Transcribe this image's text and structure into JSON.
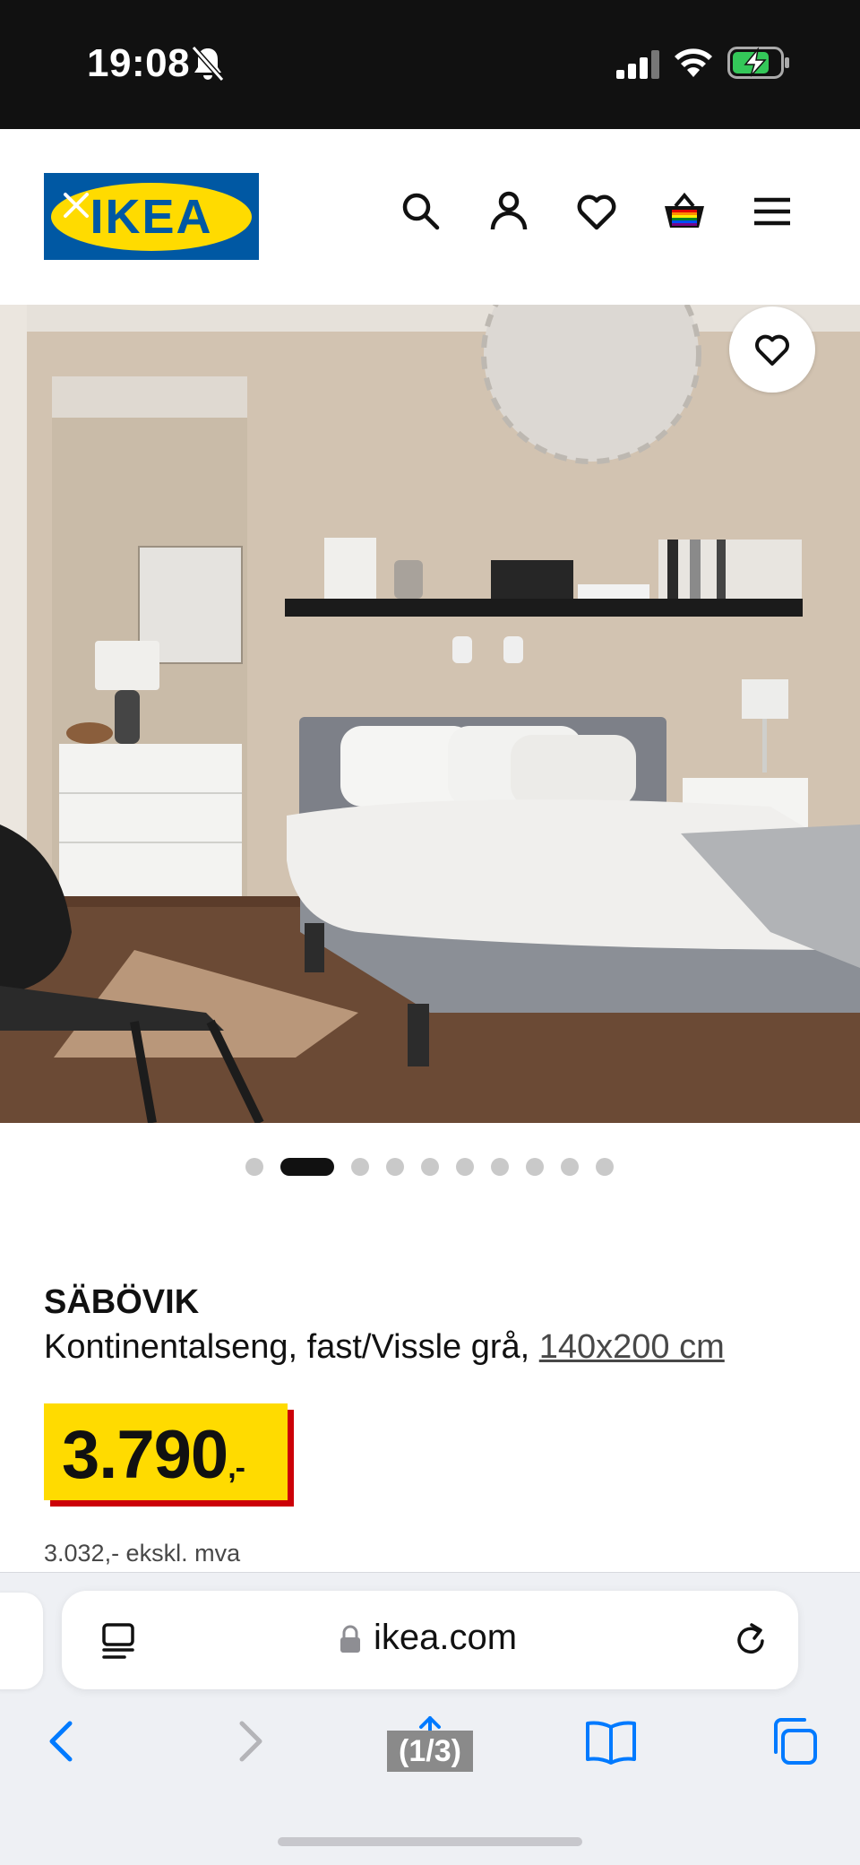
{
  "status_bar": {
    "time": "19:08",
    "icons": [
      "bell-muted-icon",
      "signal-icon",
      "wifi-icon",
      "battery-charging-icon"
    ]
  },
  "header": {
    "logo_text": "IKEA",
    "icons": [
      "search-icon",
      "account-icon",
      "heart-icon",
      "cart-icon",
      "menu-icon"
    ],
    "colors": {
      "logo_blue": "#0058a3",
      "logo_yellow": "#ffdb00"
    }
  },
  "gallery": {
    "dot_count": 10,
    "active_index": 1,
    "favorite_icon": "heart-icon"
  },
  "product": {
    "name": "SÄBÖVIK",
    "description": "Kontinentalseng, fast/Vissle grå,",
    "size": "140x200 cm",
    "price": "3.790",
    "price_suffix": ",-",
    "price_ex_vat": "3.032,- ekskl. mva",
    "colors": {
      "price_bg": "#ffdb00",
      "price_shadow": "#cc0008"
    }
  },
  "browser": {
    "url": "ikea.com",
    "page_indicator": "(1/3)",
    "icons": [
      "reader-icon",
      "lock-icon",
      "reload-icon",
      "back-icon",
      "forward-icon",
      "share-icon",
      "bookmarks-icon",
      "tabs-icon"
    ],
    "accent": "#007aff"
  }
}
